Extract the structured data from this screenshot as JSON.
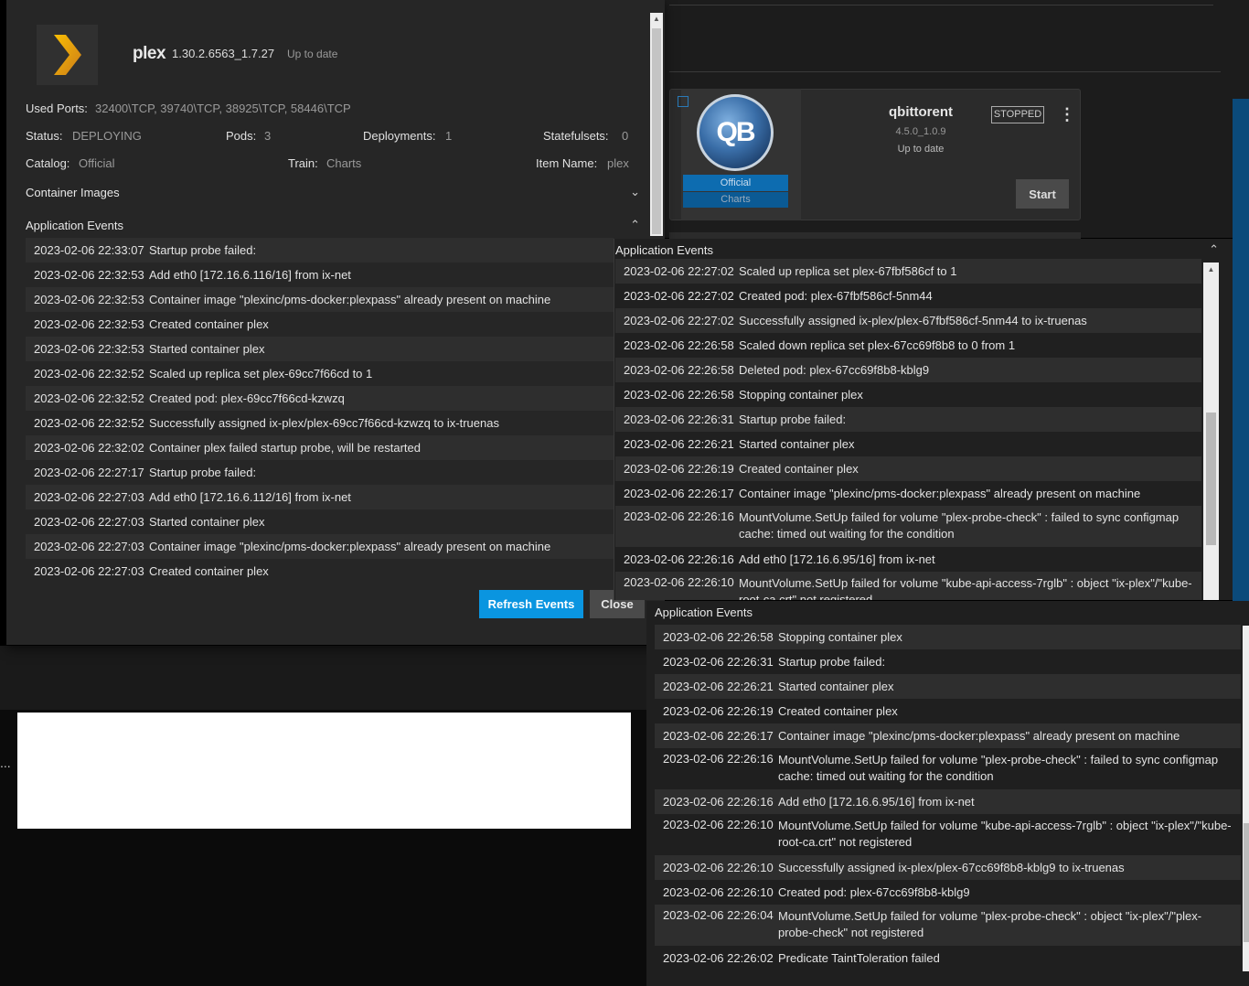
{
  "background": {
    "ellipsis": "..."
  },
  "qbittorrent": {
    "logo_text": "QB",
    "badge_official": "Official",
    "badge_charts": "Charts",
    "name": "qbittorent",
    "version": "4.5.0_1.0.9",
    "update_status": "Up to date",
    "state": "STOPPED",
    "menu_icon": "more-vertical-icon",
    "start_label": "Start"
  },
  "dialog": {
    "app_name": "plex",
    "version": "1.30.2.6563_1.7.27",
    "update_status": "Up to date",
    "used_ports_label": "Used Ports:",
    "used_ports_value": "32400\\TCP, 39740\\TCP, 38925\\TCP, 58446\\TCP",
    "status_label": "Status:",
    "status_value": "DEPLOYING",
    "pods_label": "Pods:",
    "pods_value": "3",
    "deployments_label": "Deployments:",
    "deployments_value": "1",
    "statefulsets_label": "Statefulsets:",
    "statefulsets_value": "0",
    "catalog_label": "Catalog:",
    "catalog_value": "Official",
    "train_label": "Train:",
    "train_value": "Charts",
    "item_name_label": "Item Name:",
    "item_name_value": "plex",
    "container_images_label": "Container Images",
    "app_events_label": "Application Events",
    "refresh_label": "Refresh Events",
    "close_label": "Close",
    "events": [
      {
        "ts": "2023-02-06 22:33:07",
        "msg": "Startup probe failed:"
      },
      {
        "ts": "2023-02-06 22:32:53",
        "msg": "Add eth0 [172.16.6.116/16] from ix-net"
      },
      {
        "ts": "2023-02-06 22:32:53",
        "msg": "Container image \"plexinc/pms-docker:plexpass\" already present on machine"
      },
      {
        "ts": "2023-02-06 22:32:53",
        "msg": "Created container plex"
      },
      {
        "ts": "2023-02-06 22:32:53",
        "msg": "Started container plex"
      },
      {
        "ts": "2023-02-06 22:32:52",
        "msg": "Scaled up replica set plex-69cc7f66cd to 1"
      },
      {
        "ts": "2023-02-06 22:32:52",
        "msg": "Created pod: plex-69cc7f66cd-kzwzq"
      },
      {
        "ts": "2023-02-06 22:32:52",
        "msg": "Successfully assigned ix-plex/plex-69cc7f66cd-kzwzq to ix-truenas"
      },
      {
        "ts": "2023-02-06 22:32:02",
        "msg": "Container plex failed startup probe, will be restarted"
      },
      {
        "ts": "2023-02-06 22:27:17",
        "msg": "Startup probe failed:"
      },
      {
        "ts": "2023-02-06 22:27:03",
        "msg": "Add eth0 [172.16.6.112/16] from ix-net"
      },
      {
        "ts": "2023-02-06 22:27:03",
        "msg": "Started container plex"
      },
      {
        "ts": "2023-02-06 22:27:03",
        "msg": "Container image \"plexinc/pms-docker:plexpass\" already present on machine"
      },
      {
        "ts": "2023-02-06 22:27:03",
        "msg": "Created container plex"
      }
    ]
  },
  "mid_panel": {
    "title": "Application Events",
    "events": [
      {
        "ts": "2023-02-06 22:27:02",
        "msg": "Scaled up replica set plex-67fbf586cf to 1"
      },
      {
        "ts": "2023-02-06 22:27:02",
        "msg": "Created pod: plex-67fbf586cf-5nm44"
      },
      {
        "ts": "2023-02-06 22:27:02",
        "msg": "Successfully assigned ix-plex/plex-67fbf586cf-5nm44 to ix-truenas"
      },
      {
        "ts": "2023-02-06 22:26:58",
        "msg": "Scaled down replica set plex-67cc69f8b8 to 0 from 1"
      },
      {
        "ts": "2023-02-06 22:26:58",
        "msg": "Deleted pod: plex-67cc69f8b8-kblg9"
      },
      {
        "ts": "2023-02-06 22:26:58",
        "msg": "Stopping container plex"
      },
      {
        "ts": "2023-02-06 22:26:31",
        "msg": "Startup probe failed:"
      },
      {
        "ts": "2023-02-06 22:26:21",
        "msg": "Started container plex"
      },
      {
        "ts": "2023-02-06 22:26:19",
        "msg": "Created container plex"
      },
      {
        "ts": "2023-02-06 22:26:17",
        "msg": "Container image \"plexinc/pms-docker:plexpass\" already present on machine"
      },
      {
        "ts": "2023-02-06 22:26:16",
        "msg": "MountVolume.SetUp failed for volume \"plex-probe-check\" : failed to sync configmap cache: timed out waiting for the condition"
      },
      {
        "ts": "2023-02-06 22:26:16",
        "msg": "Add eth0 [172.16.6.95/16] from ix-net"
      },
      {
        "ts": "2023-02-06 22:26:10",
        "msg": "MountVolume.SetUp failed for volume \"kube-api-access-7rglb\" : object \"ix-plex\"/\"kube-root-ca.crt\" not registered"
      }
    ]
  },
  "bottom_panel": {
    "title": "Application Events",
    "events": [
      {
        "ts": "2023-02-06 22:26:58",
        "msg": "Stopping container plex"
      },
      {
        "ts": "2023-02-06 22:26:31",
        "msg": "Startup probe failed:"
      },
      {
        "ts": "2023-02-06 22:26:21",
        "msg": "Started container plex"
      },
      {
        "ts": "2023-02-06 22:26:19",
        "msg": "Created container plex"
      },
      {
        "ts": "2023-02-06 22:26:17",
        "msg": "Container image \"plexinc/pms-docker:plexpass\" already present on machine"
      },
      {
        "ts": "2023-02-06 22:26:16",
        "msg": "MountVolume.SetUp failed for volume \"plex-probe-check\" : failed to sync configmap cache: timed out waiting for the condition"
      },
      {
        "ts": "2023-02-06 22:26:16",
        "msg": "Add eth0 [172.16.6.95/16] from ix-net"
      },
      {
        "ts": "2023-02-06 22:26:10",
        "msg": "MountVolume.SetUp failed for volume \"kube-api-access-7rglb\" : object \"ix-plex\"/\"kube-root-ca.crt\" not registered"
      },
      {
        "ts": "2023-02-06 22:26:10",
        "msg": "Successfully assigned ix-plex/plex-67cc69f8b8-kblg9 to ix-truenas"
      },
      {
        "ts": "2023-02-06 22:26:10",
        "msg": "Created pod: plex-67cc69f8b8-kblg9"
      },
      {
        "ts": "2023-02-06 22:26:04",
        "msg": "MountVolume.SetUp failed for volume \"plex-probe-check\" : object \"ix-plex\"/\"plex-probe-check\" not registered"
      },
      {
        "ts": "2023-02-06 22:26:02",
        "msg": "Predicate TaintToleration failed"
      }
    ]
  }
}
